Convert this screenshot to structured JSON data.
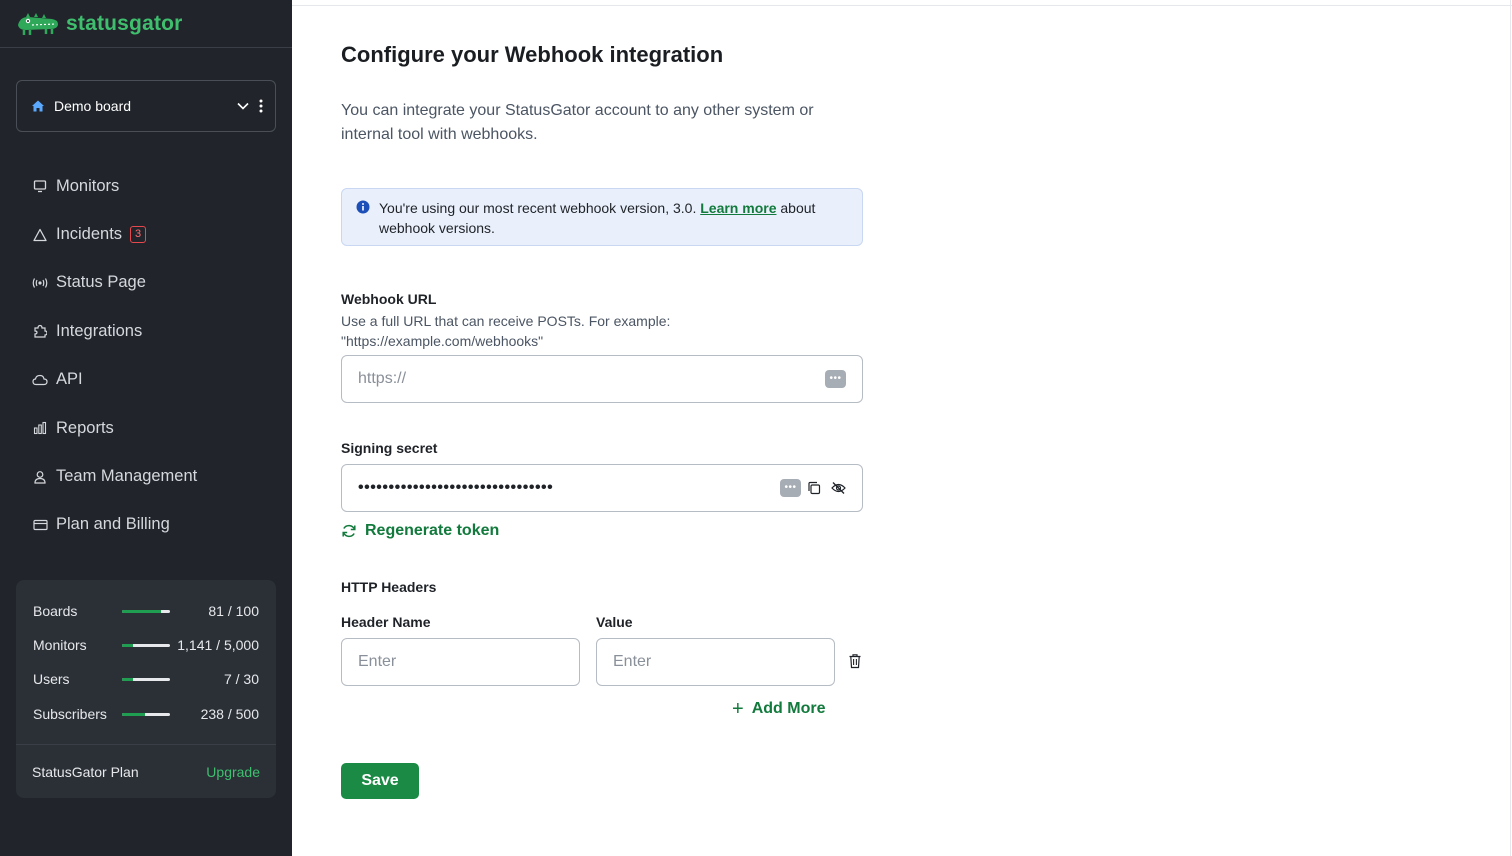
{
  "sidebar": {
    "logo_text": "statusgator",
    "board": {
      "name": "Demo board"
    },
    "nav": [
      {
        "label": "Monitors",
        "icon": "monitor-icon"
      },
      {
        "label": "Incidents",
        "icon": "warning-triangle-icon",
        "badge": "3"
      },
      {
        "label": "Status Page",
        "icon": "broadcast-icon"
      },
      {
        "label": "Integrations",
        "icon": "puzzle-icon"
      },
      {
        "label": "API",
        "icon": "cloud-icon"
      },
      {
        "label": "Reports",
        "icon": "bar-chart-icon"
      },
      {
        "label": "Team Management",
        "icon": "user-icon"
      },
      {
        "label": "Plan and Billing",
        "icon": "credit-card-icon"
      }
    ],
    "usage": [
      {
        "label": "Boards",
        "value": "81 / 100",
        "fraction": 0.81
      },
      {
        "label": "Monitors",
        "value": "1,141 / 5,000",
        "fraction": 0.23
      },
      {
        "label": "Users",
        "value": "7 / 30",
        "fraction": 0.23
      },
      {
        "label": "Subscribers",
        "value": "238 / 500",
        "fraction": 0.48
      }
    ],
    "plan": {
      "name": "StatusGator Plan",
      "upgrade_label": "Upgrade"
    }
  },
  "main": {
    "title": "Configure your Webhook integration",
    "intro": "You can integrate your StatusGator account to any other system or internal tool with webhooks.",
    "notice": {
      "text_before": "You're using our most recent webhook version, 3.0.",
      "link": "Learn more",
      "text_after": "about webhook versions."
    },
    "webhook_url": {
      "label": "Webhook URL",
      "help_line1": "Use a full URL that can receive POSTs. For example:",
      "help_line2": "\"https://example.com/webhooks\"",
      "placeholder": "https://"
    },
    "signing_secret": {
      "label": "Signing secret",
      "value": "••••••••••••••••••••••••••••••••",
      "regenerate_label": "Regenerate token"
    },
    "headers": {
      "section_label": "HTTP Headers",
      "name_label": "Header Name",
      "value_label": "Value",
      "name_placeholder": "Enter",
      "value_placeholder": "Enter",
      "add_more_label": "Add More"
    },
    "save_label": "Save"
  },
  "colors": {
    "sidebar_bg": "#21252b",
    "brand_green": "#3fbf6e",
    "action_green": "#127a3c",
    "save_button": "#1a8a44",
    "badge_red": "#e5484d",
    "notice_bg": "#eaf0fb"
  }
}
